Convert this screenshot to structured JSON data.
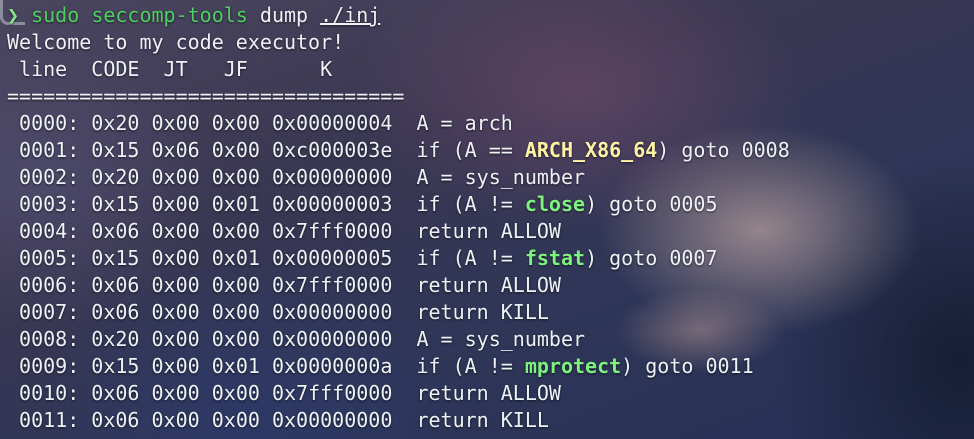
{
  "prompt": {
    "arrow": "❯",
    "sudo": "sudo",
    "tool": "seccomp-tools",
    "subcommand": "dump",
    "target": "./inj"
  },
  "output": {
    "welcome": "Welcome to my code executor!",
    "header": " line  CODE  JT   JF      K",
    "separator": "================================="
  },
  "rows": [
    {
      "addr": " 0000:",
      "code": "0x20",
      "jt": "0x00",
      "jf": "0x00",
      "k": "0x00000004",
      "pre": "A = arch",
      "hl": "",
      "post": ""
    },
    {
      "addr": " 0001:",
      "code": "0x15",
      "jt": "0x06",
      "jf": "0x00",
      "k": "0xc000003e",
      "pre": "if (A == ",
      "hl": "ARCH_X86_64",
      "post": ") goto 0008"
    },
    {
      "addr": " 0002:",
      "code": "0x20",
      "jt": "0x00",
      "jf": "0x00",
      "k": "0x00000000",
      "pre": "A = sys_number",
      "hl": "",
      "post": ""
    },
    {
      "addr": " 0003:",
      "code": "0x15",
      "jt": "0x00",
      "jf": "0x01",
      "k": "0x00000003",
      "pre": "if (A != ",
      "hl": "close",
      "post": ") goto 0005"
    },
    {
      "addr": " 0004:",
      "code": "0x06",
      "jt": "0x00",
      "jf": "0x00",
      "k": "0x7fff0000",
      "pre": "return ALLOW",
      "hl": "",
      "post": ""
    },
    {
      "addr": " 0005:",
      "code": "0x15",
      "jt": "0x00",
      "jf": "0x01",
      "k": "0x00000005",
      "pre": "if (A != ",
      "hl": "fstat",
      "post": ") goto 0007"
    },
    {
      "addr": " 0006:",
      "code": "0x06",
      "jt": "0x00",
      "jf": "0x00",
      "k": "0x7fff0000",
      "pre": "return ALLOW",
      "hl": "",
      "post": ""
    },
    {
      "addr": " 0007:",
      "code": "0x06",
      "jt": "0x00",
      "jf": "0x00",
      "k": "0x00000000",
      "pre": "return KILL",
      "hl": "",
      "post": ""
    },
    {
      "addr": " 0008:",
      "code": "0x20",
      "jt": "0x00",
      "jf": "0x00",
      "k": "0x00000000",
      "pre": "A = sys_number",
      "hl": "",
      "post": ""
    },
    {
      "addr": " 0009:",
      "code": "0x15",
      "jt": "0x00",
      "jf": "0x01",
      "k": "0x0000000a",
      "pre": "if (A != ",
      "hl": "mprotect",
      "post": ") goto 0011"
    },
    {
      "addr": " 0010:",
      "code": "0x06",
      "jt": "0x00",
      "jf": "0x00",
      "k": "0x7fff0000",
      "pre": "return ALLOW",
      "hl": "",
      "post": ""
    },
    {
      "addr": " 0011:",
      "code": "0x06",
      "jt": "0x00",
      "jf": "0x00",
      "k": "0x00000000",
      "pre": "return KILL",
      "hl": "",
      "post": ""
    }
  ],
  "colors": {
    "text": "#eef2f7",
    "command_green": "#4ed060",
    "arch_highlight": "#fff3a6",
    "syscall_highlight": "#7ef27e"
  }
}
